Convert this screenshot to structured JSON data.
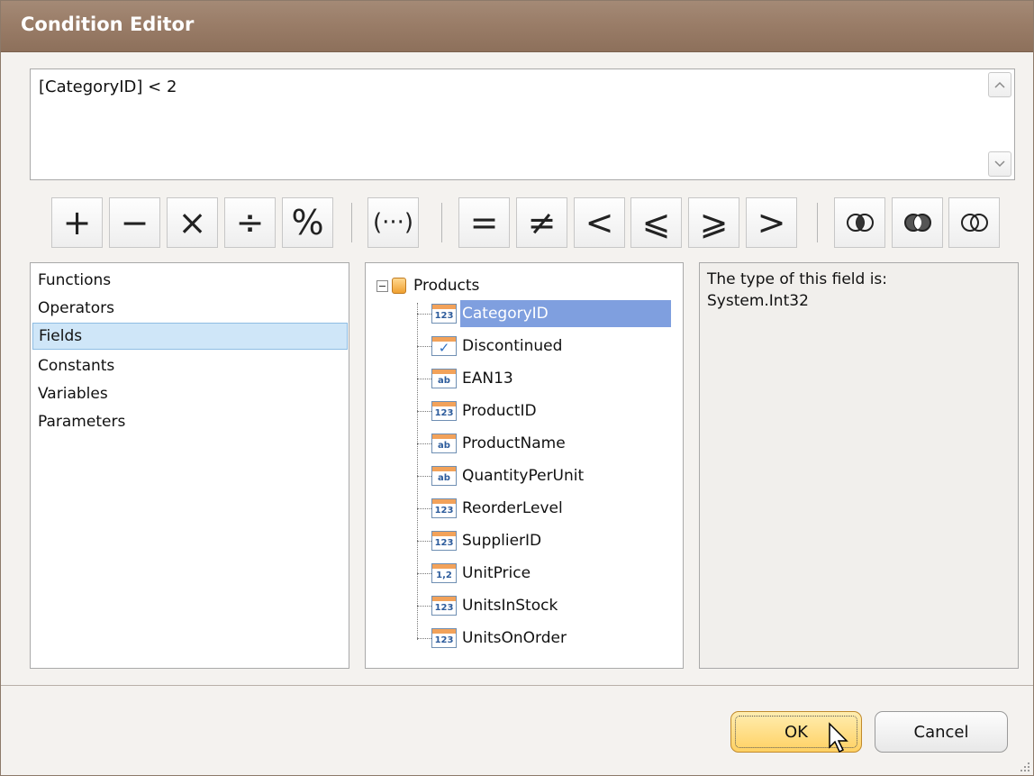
{
  "window": {
    "title": "Condition Editor"
  },
  "expression": {
    "value": "[CategoryID] < 2"
  },
  "operators": [
    {
      "name": "plus-button",
      "symbol": "+"
    },
    {
      "name": "minus-button",
      "symbol": "−"
    },
    {
      "name": "multiply-button",
      "symbol": "×"
    },
    {
      "name": "divide-button",
      "symbol": "÷"
    },
    {
      "name": "modulo-button",
      "symbol": "%"
    },
    {
      "name": "parentheses-button",
      "symbol": "(···)"
    },
    {
      "name": "equal-button",
      "symbol": "="
    },
    {
      "name": "not-equal-button",
      "symbol": "≠"
    },
    {
      "name": "less-button",
      "symbol": "<"
    },
    {
      "name": "less-or-equal-button",
      "symbol": "⩽"
    },
    {
      "name": "greater-or-equal-button",
      "symbol": "⩾"
    },
    {
      "name": "greater-button",
      "symbol": ">"
    },
    {
      "name": "and-button",
      "icon": "logical-and-icon"
    },
    {
      "name": "or-button",
      "icon": "logical-or-icon"
    },
    {
      "name": "not-button",
      "icon": "logical-not-icon"
    }
  ],
  "categories": [
    {
      "label": "Functions",
      "selected": false
    },
    {
      "label": "Operators",
      "selected": false
    },
    {
      "label": "Fields",
      "selected": true
    },
    {
      "label": "Constants",
      "selected": false
    },
    {
      "label": "Variables",
      "selected": false
    },
    {
      "label": "Parameters",
      "selected": false
    }
  ],
  "tree": {
    "root": "Products",
    "items": [
      {
        "label": "CategoryID",
        "type_icon": "123",
        "selected": true
      },
      {
        "label": "Discontinued",
        "type_icon": "check",
        "selected": false
      },
      {
        "label": "EAN13",
        "type_icon": "ab",
        "selected": false
      },
      {
        "label": "ProductID",
        "type_icon": "123",
        "selected": false
      },
      {
        "label": "ProductName",
        "type_icon": "ab",
        "selected": false
      },
      {
        "label": "QuantityPerUnit",
        "type_icon": "ab",
        "selected": false
      },
      {
        "label": "ReorderLevel",
        "type_icon": "123",
        "selected": false
      },
      {
        "label": "SupplierID",
        "type_icon": "123",
        "selected": false
      },
      {
        "label": "UnitPrice",
        "type_icon": "1,2",
        "selected": false
      },
      {
        "label": "UnitsInStock",
        "type_icon": "123",
        "selected": false
      },
      {
        "label": "UnitsOnOrder",
        "type_icon": "123",
        "selected": false
      }
    ]
  },
  "description": {
    "line1": "The type of this field is:",
    "line2": "System.Int32"
  },
  "buttons": {
    "ok": "OK",
    "cancel": "Cancel"
  },
  "icons": {
    "check_glyph": "✓"
  }
}
